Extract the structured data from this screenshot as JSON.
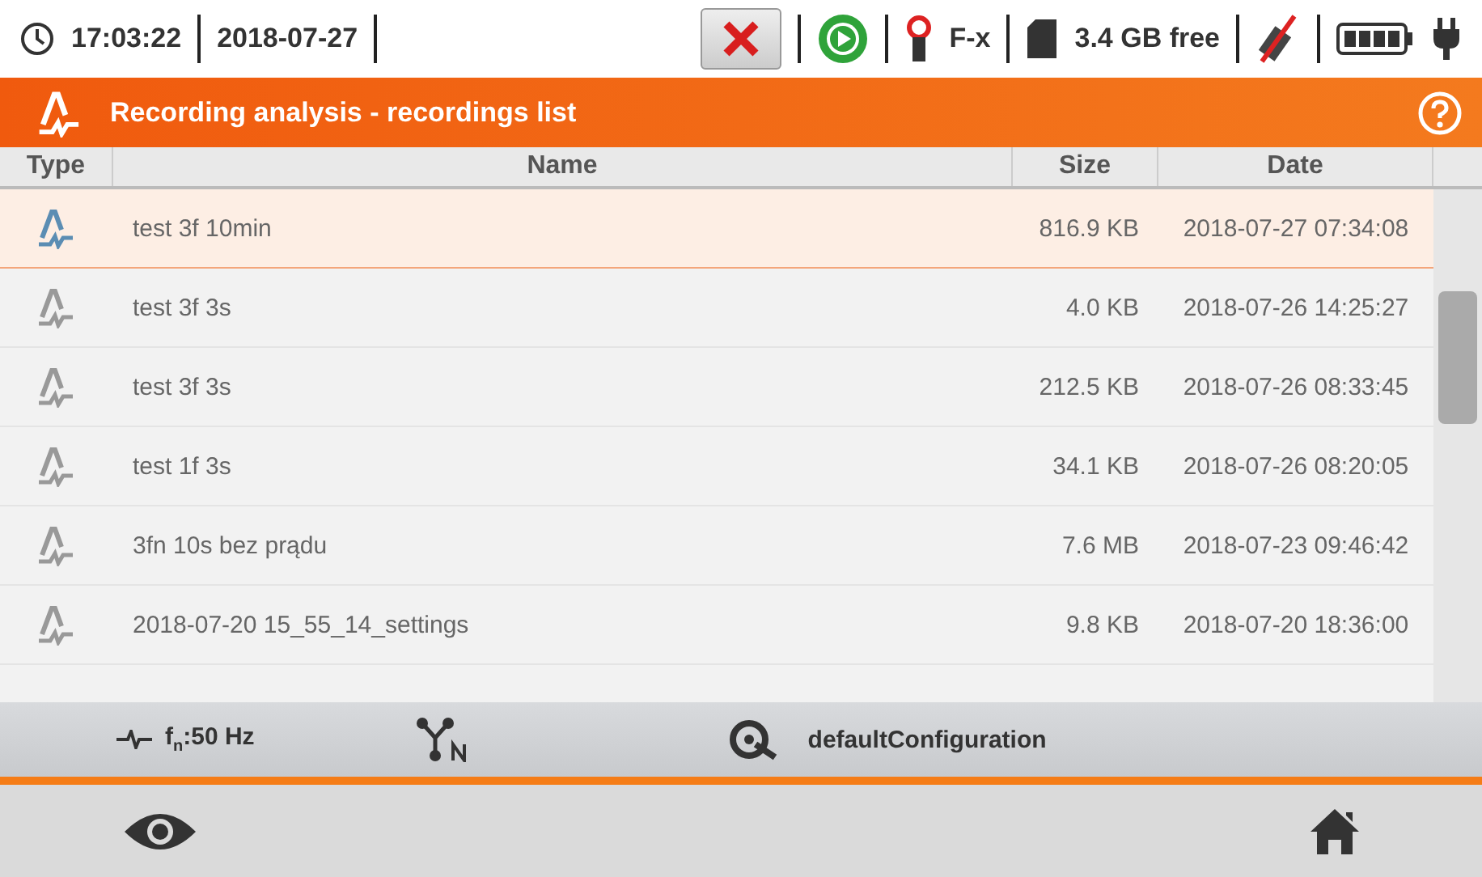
{
  "status_bar": {
    "time": "17:03:22",
    "date": "2018-07-27",
    "clamp_label": "F-x",
    "storage": "3.4 GB free"
  },
  "header": {
    "title": "Recording analysis - recordings list"
  },
  "table": {
    "columns": [
      "Type",
      "Name",
      "Size",
      "Date"
    ],
    "rows": [
      {
        "name": "test 3f 10min",
        "size": "816.9 KB",
        "date": "2018-07-27 07:34:08",
        "selected": true
      },
      {
        "name": "test 3f 3s",
        "size": "4.0 KB",
        "date": "2018-07-26 14:25:27",
        "selected": false
      },
      {
        "name": "test 3f 3s",
        "size": "212.5 KB",
        "date": "2018-07-26 08:33:45",
        "selected": false
      },
      {
        "name": "test 1f 3s",
        "size": "34.1 KB",
        "date": "2018-07-26 08:20:05",
        "selected": false
      },
      {
        "name": "3fn 10s bez prądu",
        "size": "7.6 MB",
        "date": "2018-07-23 09:46:42",
        "selected": false
      },
      {
        "name": "2018-07-20 15_55_14_settings",
        "size": "9.8 KB",
        "date": "2018-07-20 18:36:00",
        "selected": false
      }
    ]
  },
  "info_bar": {
    "frequency": "f$_{n}$:50 Hz",
    "configuration": "defaultConfiguration"
  }
}
